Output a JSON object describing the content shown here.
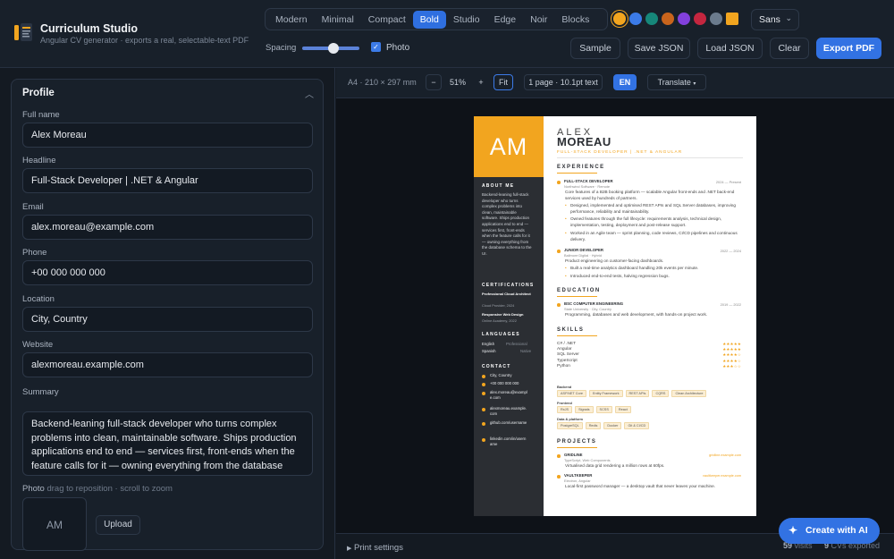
{
  "app": {
    "title": "Curriculum Studio",
    "subtitle": "Angular CV generator · exports a real, selectable-text PDF"
  },
  "themes": [
    {
      "label": "Modern",
      "active": false
    },
    {
      "label": "Minimal",
      "active": false
    },
    {
      "label": "Compact",
      "active": false
    },
    {
      "label": "Bold",
      "active": true
    },
    {
      "label": "Studio",
      "active": false
    },
    {
      "label": "Edge",
      "active": false
    },
    {
      "label": "Noir",
      "active": false
    },
    {
      "label": "Blocks",
      "active": false
    }
  ],
  "accents": [
    {
      "color": "#f2a51f",
      "selected": true
    },
    {
      "color": "#3b7be8",
      "selected": false
    },
    {
      "color": "#16877a",
      "selected": false
    },
    {
      "color": "#c8641c",
      "selected": false
    },
    {
      "color": "#8240dc",
      "selected": false
    },
    {
      "color": "#c4263f",
      "selected": false
    },
    {
      "color": "#6b7b8d",
      "selected": false
    },
    {
      "color": "#f2a51f",
      "selected": false
    }
  ],
  "font": {
    "value": "Sans"
  },
  "toolbar": {
    "spacing_label": "Spacing",
    "spacing_value": 0.55,
    "photo_label": "Photo",
    "photo_checked": true,
    "sample": "Sample",
    "save_json": "Save JSON",
    "load_json": "Load JSON",
    "clear": "Clear",
    "export_pdf": "Export PDF"
  },
  "profile": {
    "title": "Profile",
    "full_name_label": "Full name",
    "full_name": "Alex Moreau",
    "headline_label": "Headline",
    "headline": "Full-Stack Developer | .NET & Angular",
    "email_label": "Email",
    "email": "alex.moreau@example.com",
    "phone_label": "Phone",
    "phone": "+00 000 000 000",
    "location_label": "Location",
    "location": "City, Country",
    "website_label": "Website",
    "website": "alexmoreau.example.com",
    "summary_label": "Summary",
    "summary": "Backend-leaning full-stack developer who turns complex problems into clean, maintainable software. Ships production applications end to end — services first, front-ends when the feature calls for it — owning everything from the database schema to the UI.",
    "photo_label": "Photo",
    "photo_hint": "drag to reposition · scroll to zoom",
    "photo_initials": "AM",
    "upload": "Upload"
  },
  "preview_toolbar": {
    "paper": "A4 · 210 × 297 mm",
    "zoom_out": "−",
    "zoom": "51%",
    "zoom_in": "+",
    "fit": "Fit",
    "page_info": "1 page · 10.1pt text",
    "lang": "EN",
    "translate": "Translate"
  },
  "footer": {
    "print_settings": "Print settings",
    "visits_count": "59",
    "visits_label": "visits",
    "exports_count": "9",
    "exports_label": "CVs exported"
  },
  "ai_button": "Create with AI",
  "resume": {
    "initials": "AM",
    "first_name": "ALEX",
    "last_name": "MOREAU",
    "title": "FULL-STACK DEVELOPER | .NET & ANGULAR",
    "about_h": "ABOUT ME",
    "about": "Backend-leaning full-stack developer who turns complex problems into clean, maintainable software. Ships production applications end to end — services first, front-ends when the feature calls for it — owning everything from the database schema to the UI.",
    "cert_h": "CERTIFICATIONS",
    "certs": [
      {
        "name": "Professional Cloud Architect",
        "meta": "Cloud Provider, 2024"
      },
      {
        "name": "Responsive Web Design",
        "meta": "Online Academy, 2022"
      }
    ],
    "lang_h": "LANGUAGES",
    "languages": [
      {
        "name": "English",
        "level": "Professional"
      },
      {
        "name": "Spanish",
        "level": "Native"
      }
    ],
    "contact_h": "CONTACT",
    "contacts": [
      "City, Country",
      "+00 000 000 000",
      "alex.moreau@example.com",
      "alexmoreau.example.com",
      "github.com/username",
      "linkedin.com/in/username"
    ],
    "exp_h": "EXPERIENCE",
    "jobs": [
      {
        "title": "FULL-STACK DEVELOPER",
        "dates": "2024 — Present",
        "company": "Northwind Software · Remote",
        "summary": "Core features of a B2B booking platform — scalable Angular front-ends and .NET back-end services used by hundreds of partners.",
        "bullets": [
          "Designed, implemented and optimised REST APIs and SQL Server databases, improving performance, reliability and maintainability.",
          "Owned features through the full lifecycle: requirements analysis, technical design, implementation, testing, deployment and post-release support.",
          "Worked in an Agile team — sprint planning, code reviews, CI/CD pipelines and continuous delivery."
        ]
      },
      {
        "title": "JUNIOR DEVELOPER",
        "dates": "2022 — 2024",
        "company": "Ballmore Digital · Hybrid",
        "summary": "Product engineering on customer-facing dashboards.",
        "bullets": [
          "Built a real-time analytics dashboard handling 20k events per minute.",
          "Introduced end-to-end tests, halving regression bugs."
        ]
      }
    ],
    "edu_h": "EDUCATION",
    "edu": {
      "title": "BSC COMPUTER ENGINEERING",
      "dates": "2019 — 2022",
      "school": "State University · City, Country",
      "desc": "Programming, databases and web development, with hands-on project work."
    },
    "skills_h": "SKILLS",
    "skills": [
      {
        "name": "C# / .NET",
        "stars": "★★★★★"
      },
      {
        "name": "Angular",
        "stars": "★★★★★"
      },
      {
        "name": "SQL Server",
        "stars": "★★★★☆"
      },
      {
        "name": "TypeScript",
        "stars": "★★★★☆"
      },
      {
        "name": "Python",
        "stars": "★★★☆☆"
      }
    ],
    "skill_groups": [
      {
        "name": "Backend",
        "items": [
          "ASP.NET Core",
          "Entity Framework",
          "REST APIs",
          "CQRS",
          "Clean Architecture"
        ]
      },
      {
        "name": "Frontend",
        "items": [
          "RxJS",
          "Signals",
          "SCSS",
          "React"
        ]
      },
      {
        "name": "Data & platform",
        "items": [
          "PostgreSQL",
          "Redis",
          "Docker",
          "Git & CI/CD"
        ]
      }
    ],
    "proj_h": "PROJECTS",
    "projects": [
      {
        "name": "GRIDLINE",
        "link": "gridline.example.com",
        "tech": "TypeScript, Web Components",
        "desc": "Virtualised data grid rendering a million rows at 60fps."
      },
      {
        "name": "VAULTKEEPER",
        "link": "vaultkeeper.example.com",
        "tech": "Electron, Angular",
        "desc": "Local-first password manager — a desktop vault that never leaves your machine."
      }
    ]
  }
}
